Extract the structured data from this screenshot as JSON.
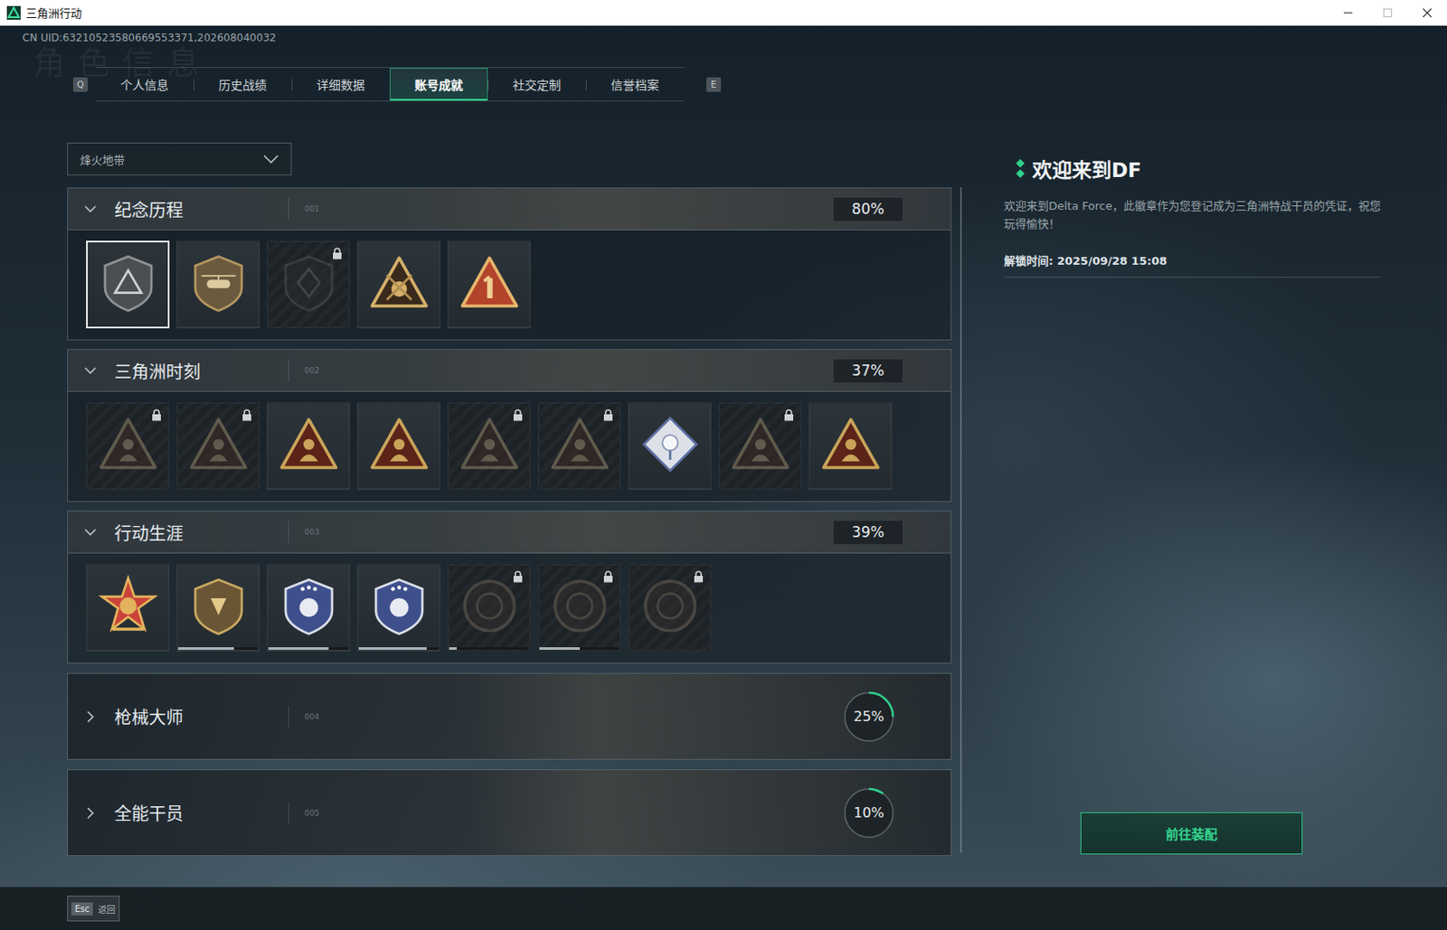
{
  "window": {
    "title": "三角洲行动"
  },
  "uid": "CN UID:63210523580669553371,202608040032",
  "watermark": "角色信息",
  "tabs": {
    "prev_key": "Q",
    "next_key": "E",
    "items": [
      {
        "label": "个人信息",
        "selected": false
      },
      {
        "label": "历史战绩",
        "selected": false
      },
      {
        "label": "详细数据",
        "selected": false
      },
      {
        "label": "账号成就",
        "selected": true
      },
      {
        "label": "社交定制",
        "selected": false
      },
      {
        "label": "信誉档案",
        "selected": false
      }
    ]
  },
  "mode_select": {
    "value": "烽火地带"
  },
  "sections": [
    {
      "title": "纪念历程",
      "number": "001",
      "percent": "80%",
      "expanded": true,
      "badges": [
        {
          "locked": false,
          "selected": true
        },
        {
          "locked": false,
          "selected": false
        },
        {
          "locked": true,
          "selected": false
        },
        {
          "locked": false,
          "selected": false
        },
        {
          "locked": false,
          "selected": false
        }
      ]
    },
    {
      "title": "三角洲时刻",
      "number": "002",
      "percent": "37%",
      "expanded": true,
      "badges": [
        {
          "locked": true,
          "selected": false
        },
        {
          "locked": true,
          "selected": false
        },
        {
          "locked": false,
          "selected": false
        },
        {
          "locked": false,
          "selected": false
        },
        {
          "locked": true,
          "selected": false
        },
        {
          "locked": true,
          "selected": false
        },
        {
          "locked": false,
          "selected": false
        },
        {
          "locked": true,
          "selected": false
        },
        {
          "locked": false,
          "selected": false
        }
      ]
    },
    {
      "title": "行动生涯",
      "number": "003",
      "percent": "39%",
      "expanded": true,
      "badges": [
        {
          "locked": false,
          "selected": false
        },
        {
          "locked": false,
          "selected": false,
          "level": 0.7
        },
        {
          "locked": false,
          "selected": false,
          "level": 0.75
        },
        {
          "locked": false,
          "selected": false,
          "level": 0.85
        },
        {
          "locked": true,
          "selected": false,
          "level": 0.1
        },
        {
          "locked": true,
          "selected": false,
          "level": 0.5
        },
        {
          "locked": true,
          "selected": false
        }
      ]
    },
    {
      "title": "枪械大师",
      "number": "004",
      "percent": "25%",
      "expanded": false,
      "level": 0.25
    },
    {
      "title": "全能干员",
      "number": "005",
      "percent": "10%",
      "expanded": false,
      "level": 0.1
    }
  ],
  "detail": {
    "title": "欢迎来到DF",
    "description": "欢迎来到Delta Force，此徽章作为您登记成为三角洲特战干员的凭证，祝您玩得愉快！",
    "unlock_time": "解锁时间: 2025/09/28 15:08",
    "button": "前往装配"
  },
  "footer": {
    "key": "Esc",
    "label": "返回"
  }
}
